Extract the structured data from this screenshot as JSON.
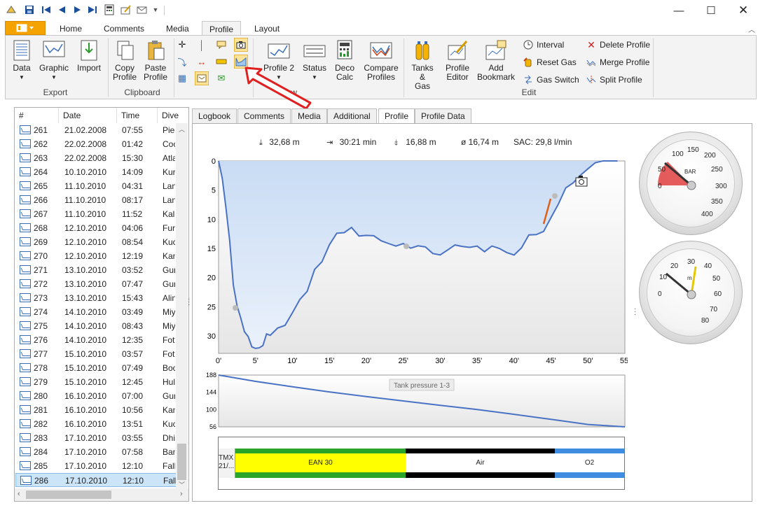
{
  "ribbon_tabs": [
    "Home",
    "Comments",
    "Media",
    "Profile",
    "Layout"
  ],
  "active_tab": "Profile",
  "ribbon": {
    "data": "Data",
    "graphic": "Graphic",
    "import": "Import",
    "copy_profile": [
      "Copy",
      "Profile"
    ],
    "paste_profile": [
      "Paste",
      "Profile"
    ],
    "profile2": [
      "Profile 2"
    ],
    "status": "Status",
    "deco_calc": [
      "Deco",
      "Calc"
    ],
    "compare_profiles": [
      "Compare",
      "Profiles"
    ],
    "tanks_gas": [
      "Tanks &",
      "Gas"
    ],
    "profile_editor": [
      "Profile",
      "Editor"
    ],
    "add_bookmark": [
      "Add",
      "Bookmark"
    ],
    "interval": "Interval",
    "reset_gas": "Reset Gas",
    "gas_switch": "Gas Switch",
    "delete_profile": "Delete Profile",
    "merge_profile": "Merge Profile",
    "split_profile": "Split Profile",
    "groups": {
      "export": "Export",
      "clipboard": "Clipboard",
      "view": "View",
      "edit": "Edit"
    }
  },
  "list": {
    "headers": [
      "#",
      "Date",
      "Time",
      "Dive"
    ],
    "rows": [
      [
        "261",
        "21.02.2008",
        "07:55",
        "Pier"
      ],
      [
        "262",
        "22.02.2008",
        "01:42",
        "Coc"
      ],
      [
        "263",
        "22.02.2008",
        "15:30",
        "Atla"
      ],
      [
        "264",
        "10.10.2010",
        "14:09",
        "Kur"
      ],
      [
        "265",
        "11.10.2010",
        "04:31",
        "Lan"
      ],
      [
        "266",
        "11.10.2010",
        "08:17",
        "Lan"
      ],
      [
        "267",
        "11.10.2010",
        "11:52",
        "Kalh"
      ],
      [
        "268",
        "12.10.2010",
        "04:06",
        "Fura"
      ],
      [
        "269",
        "12.10.2010",
        "08:54",
        "Kuc"
      ],
      [
        "270",
        "12.10.2010",
        "12:19",
        "Kan"
      ],
      [
        "271",
        "13.10.2010",
        "03:52",
        "Gur"
      ],
      [
        "272",
        "13.10.2010",
        "07:47",
        "Gur"
      ],
      [
        "273",
        "13.10.2010",
        "15:43",
        "Alin"
      ],
      [
        "274",
        "14.10.2010",
        "03:49",
        "Miy"
      ],
      [
        "275",
        "14.10.2010",
        "08:43",
        "Miy"
      ],
      [
        "276",
        "14.10.2010",
        "12:35",
        "Fott"
      ],
      [
        "277",
        "15.10.2010",
        "03:57",
        "Fott"
      ],
      [
        "278",
        "15.10.2010",
        "07:49",
        "Boo"
      ],
      [
        "279",
        "15.10.2010",
        "12:45",
        "Hul"
      ],
      [
        "280",
        "16.10.2010",
        "07:00",
        "Gur"
      ],
      [
        "281",
        "16.10.2010",
        "10:56",
        "Kan"
      ],
      [
        "282",
        "16.10.2010",
        "13:51",
        "Kuc"
      ],
      [
        "283",
        "17.10.2010",
        "03:55",
        "Dhi"
      ],
      [
        "284",
        "17.10.2010",
        "07:58",
        "Ban"
      ],
      [
        "285",
        "17.10.2010",
        "12:10",
        "Falh"
      ],
      [
        "286",
        "17.10.2010",
        "12:10",
        "Falh"
      ]
    ],
    "selected": "286"
  },
  "panel_tabs": [
    "Logbook",
    "Comments",
    "Media",
    "Additional",
    "Profile",
    "Profile Data"
  ],
  "active_panel_tab": "Profile",
  "stats": {
    "max_depth": "32,68 m",
    "duration": "30:21 min",
    "avg_icon_value": "16,88 m",
    "avg_depth": "ø 16,74 m",
    "sac": "SAC: 29,8 l/min"
  },
  "chart_data": [
    {
      "type": "area",
      "y_ticks": [
        "0",
        "5",
        "10",
        "15",
        "20",
        "25",
        "30"
      ],
      "x_ticks": [
        "0'",
        "5'",
        "10'",
        "15'",
        "20'",
        "25'",
        "30'",
        "35'",
        "40'",
        "45'",
        "50'",
        "55'"
      ],
      "xlim": [
        0,
        55
      ],
      "ylim": [
        0,
        33
      ],
      "x": [
        0,
        0.5,
        1,
        1.5,
        2,
        2.5,
        3,
        3.5,
        4,
        4.5,
        5,
        5.5,
        6,
        6.5,
        7,
        8,
        9,
        10,
        11,
        12,
        13,
        14,
        15,
        16,
        17,
        18,
        19,
        20,
        21,
        22,
        23,
        24,
        25,
        26,
        27,
        28,
        29,
        30,
        31,
        32,
        33,
        34,
        35,
        36,
        37,
        38,
        39,
        40,
        41,
        42,
        43,
        44,
        45,
        46,
        47,
        48,
        49,
        50,
        51,
        52,
        53,
        54
      ],
      "y": [
        0,
        3,
        8,
        14,
        21,
        25,
        27,
        29,
        30.5,
        31.5,
        32.4,
        32,
        31.5,
        30,
        29.5,
        29,
        28,
        26,
        24,
        22,
        19,
        17,
        14.5,
        12.5,
        12,
        11.8,
        12.5,
        13,
        12.8,
        13.5,
        14.5,
        14.2,
        14.5,
        14.8,
        14.5,
        15,
        15.5,
        16.5,
        15,
        14.5,
        14.8,
        14.5,
        15,
        15.2,
        14.8,
        15,
        15.5,
        16.5,
        14.5,
        13,
        12.5,
        12,
        10,
        7,
        5,
        3.5,
        2.5,
        1.5,
        0.3,
        0,
        0,
        0
      ]
    },
    {
      "type": "line",
      "title": "Tank pressure 1-3",
      "y_ticks": [
        "188",
        "144",
        "100",
        "56"
      ],
      "xlim": [
        0,
        55
      ],
      "ylim": [
        56,
        188
      ],
      "x": [
        0,
        5,
        10,
        15,
        20,
        25,
        30,
        35,
        40,
        45,
        50,
        55
      ],
      "y": [
        188,
        172,
        158,
        145,
        133,
        122,
        111,
        100,
        88,
        75,
        62,
        56
      ]
    }
  ],
  "gas_bar": {
    "labels": [
      "TMX 21/...",
      "EAN 30",
      "Air",
      "O2"
    ],
    "colors": [
      "#b0b0b0",
      "#ffff00",
      "#ffffff",
      "#ffffff"
    ]
  },
  "gauges": {
    "pressure": {
      "unit": "BAR",
      "labels": [
        "0",
        "50",
        "100",
        "150",
        "200",
        "250",
        "300",
        "350",
        "400"
      ]
    },
    "depth": {
      "unit": "m",
      "labels": [
        "0",
        "10",
        "20",
        "30",
        "40",
        "50",
        "60",
        "70",
        "80"
      ]
    }
  }
}
